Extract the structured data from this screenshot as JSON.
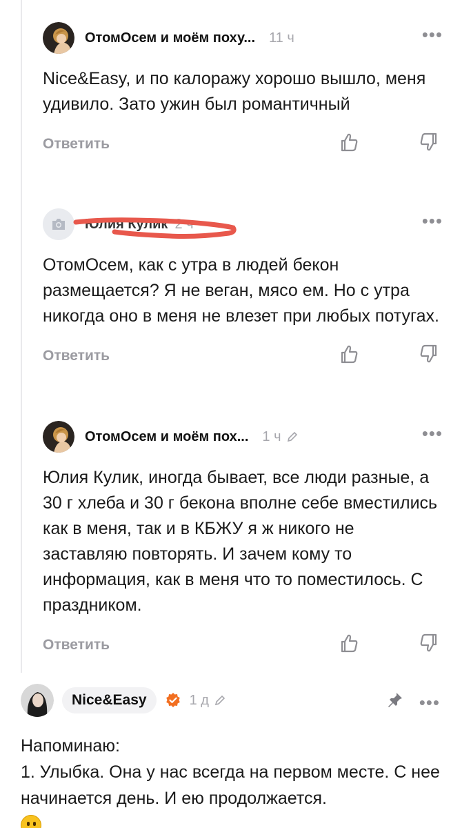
{
  "comments": [
    {
      "author": "ОтомОсем и моём поху...",
      "time": "11 ч",
      "text": "Nice&Easy, и по калоражу хорошо вышло, меня удивило. Зато ужин был романтичный",
      "reply_label": "Ответить",
      "avatar": "profile-photo"
    },
    {
      "author": "Юлия Кулик",
      "time": "2 ч",
      "text": "ОтомОсем, как с утра в людей бекон размещается? Я не веган, мясо ем. Но с утра никогда оно в меня не влезет при любых потугах.",
      "reply_label": "Ответить",
      "avatar": "camera-placeholder-icon",
      "name_redacted_color": "#e8584c"
    },
    {
      "author": "ОтомОсем и моём пох...",
      "time": "1 ч",
      "edited": true,
      "text": "Юлия Кулик, иногда бывает, все люди разные, а 30 г хлеба и 30 г бекона вполне себе вместились как в меня, так и в КБЖУ я ж никого не заставляю повторять. И зачем кому то информация, как в меня что то поместилось. С праздником.",
      "reply_label": "Ответить",
      "avatar": "profile-photo"
    }
  ],
  "root_comment": {
    "author": "Nice&Easy",
    "verified": true,
    "time": "1 д",
    "edited": true,
    "pinned": true,
    "lines": [
      "Напоминаю:",
      "1. Улыбка. Она у нас всегда на первом месте. С нее начинается день. И ею продолжается."
    ],
    "emoji": "grinning-face"
  },
  "colors": {
    "accent_verified": "#f26f21",
    "muted_text": "#9b9ba1",
    "thread_line": "#e9e9ec"
  }
}
